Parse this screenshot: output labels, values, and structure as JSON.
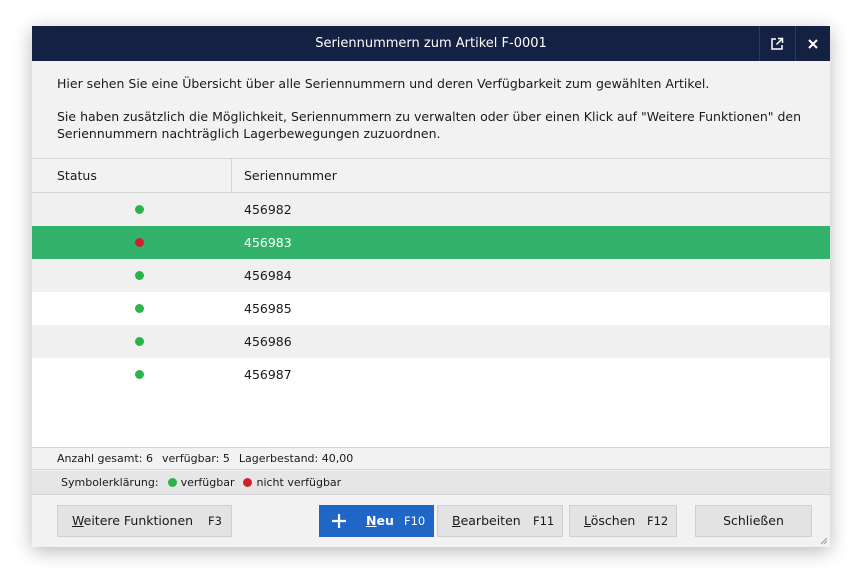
{
  "window": {
    "title": "Seriennummern zum Artikel F-0001",
    "popout_icon": "external-link-icon",
    "close_icon": "close-icon"
  },
  "intro": {
    "line1": "Hier sehen Sie eine Übersicht über alle Seriennummern und deren Verfügbarkeit zum gewählten Artikel.",
    "line2": "Sie haben zusätzlich die Möglichkeit, Seriennummern zu verwalten oder über einen Klick auf \"Weitere Funktionen\" den Seriennummern nachträglich Lagerbewegungen zuzuordnen."
  },
  "grid": {
    "columns": [
      "Status",
      "Seriennummer"
    ],
    "rows": [
      {
        "status": "available",
        "serial": "456982"
      },
      {
        "status": "unavailable",
        "serial": "456983",
        "selected": true
      },
      {
        "status": "available",
        "serial": "456984"
      },
      {
        "status": "available",
        "serial": "456985"
      },
      {
        "status": "available",
        "serial": "456986"
      },
      {
        "status": "available",
        "serial": "456987"
      }
    ]
  },
  "summary": {
    "total": "Anzahl gesamt: 6",
    "available": "verfügbar: 5",
    "stock": "Lagerbestand: 40,00"
  },
  "legend": {
    "label": "Symbolerklärung:",
    "available": "verfügbar",
    "unavailable": "nicht verfügbar"
  },
  "colors": {
    "available": "#2db34a",
    "unavailable": "#d0202e",
    "selected_row": "#32b26b",
    "titlebar": "#152142",
    "primary_button": "#1f66c7"
  },
  "buttons": {
    "more": {
      "label_underlined": "W",
      "label_rest": "eitere Funktionen",
      "key": "F3"
    },
    "new": {
      "label_underlined": "N",
      "label_rest": "eu",
      "key": "F10",
      "icon": "plus-icon"
    },
    "edit": {
      "label_underlined": "B",
      "label_rest": "earbeiten",
      "key": "F11"
    },
    "delete": {
      "label_underlined": "L",
      "label_rest": "öschen",
      "key": "F12"
    },
    "close": {
      "label": "Schließen"
    }
  }
}
